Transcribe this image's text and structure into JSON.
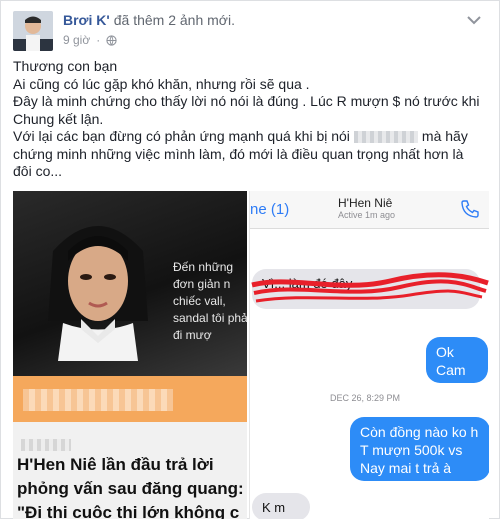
{
  "post": {
    "author": "Brơi K'",
    "action": "đã thêm 2 ảnh mới.",
    "time": "9 giờ",
    "lines": [
      "Thương con bạn",
      "Ai cũng có lúc gặp khó khăn, nhưng rồi sẽ qua .",
      "Đây là minh chứng cho thấy lời nó nói là đúng . Lúc R mượn $ nó trước khi Chung kết lận."
    ],
    "last_line_start": "Với lại các bạn đừng có phản ứng mạnh quá khi bị nói",
    "last_line_end": "mà hãy chứng minh những việc mình làm, đó mới là điều quan trọng nhất hơn là đôi co..."
  },
  "left_image": {
    "overlay_text": "Đến những đơn giản n chiếc vali, sandal tôi phải đi mượ",
    "headline": "H'Hen Niê lần đầu trả lời phỏng vấn sau đăng quang: \"Đi thi cuộc thi lớn không c"
  },
  "chat": {
    "back_label": "ne (1)",
    "contact_name": "H'Hen Niê",
    "contact_status": "Active 1m ago",
    "scribbled_text": "Vì... làm đó đây",
    "reply_ok": "Ok\nCam ơ",
    "timestamp": "DEC 26, 8:29 PM",
    "message_out": "Còn đồng nào ko h\nT mượn 500k vs\nNay mai t trả à",
    "reply_kmoi": "K m ơi"
  },
  "colors": {
    "link_blue": "#365899",
    "imessage_blue": "#2d8cf7",
    "scribble_red": "#e8202a",
    "orange_band": "#f5a85c"
  }
}
